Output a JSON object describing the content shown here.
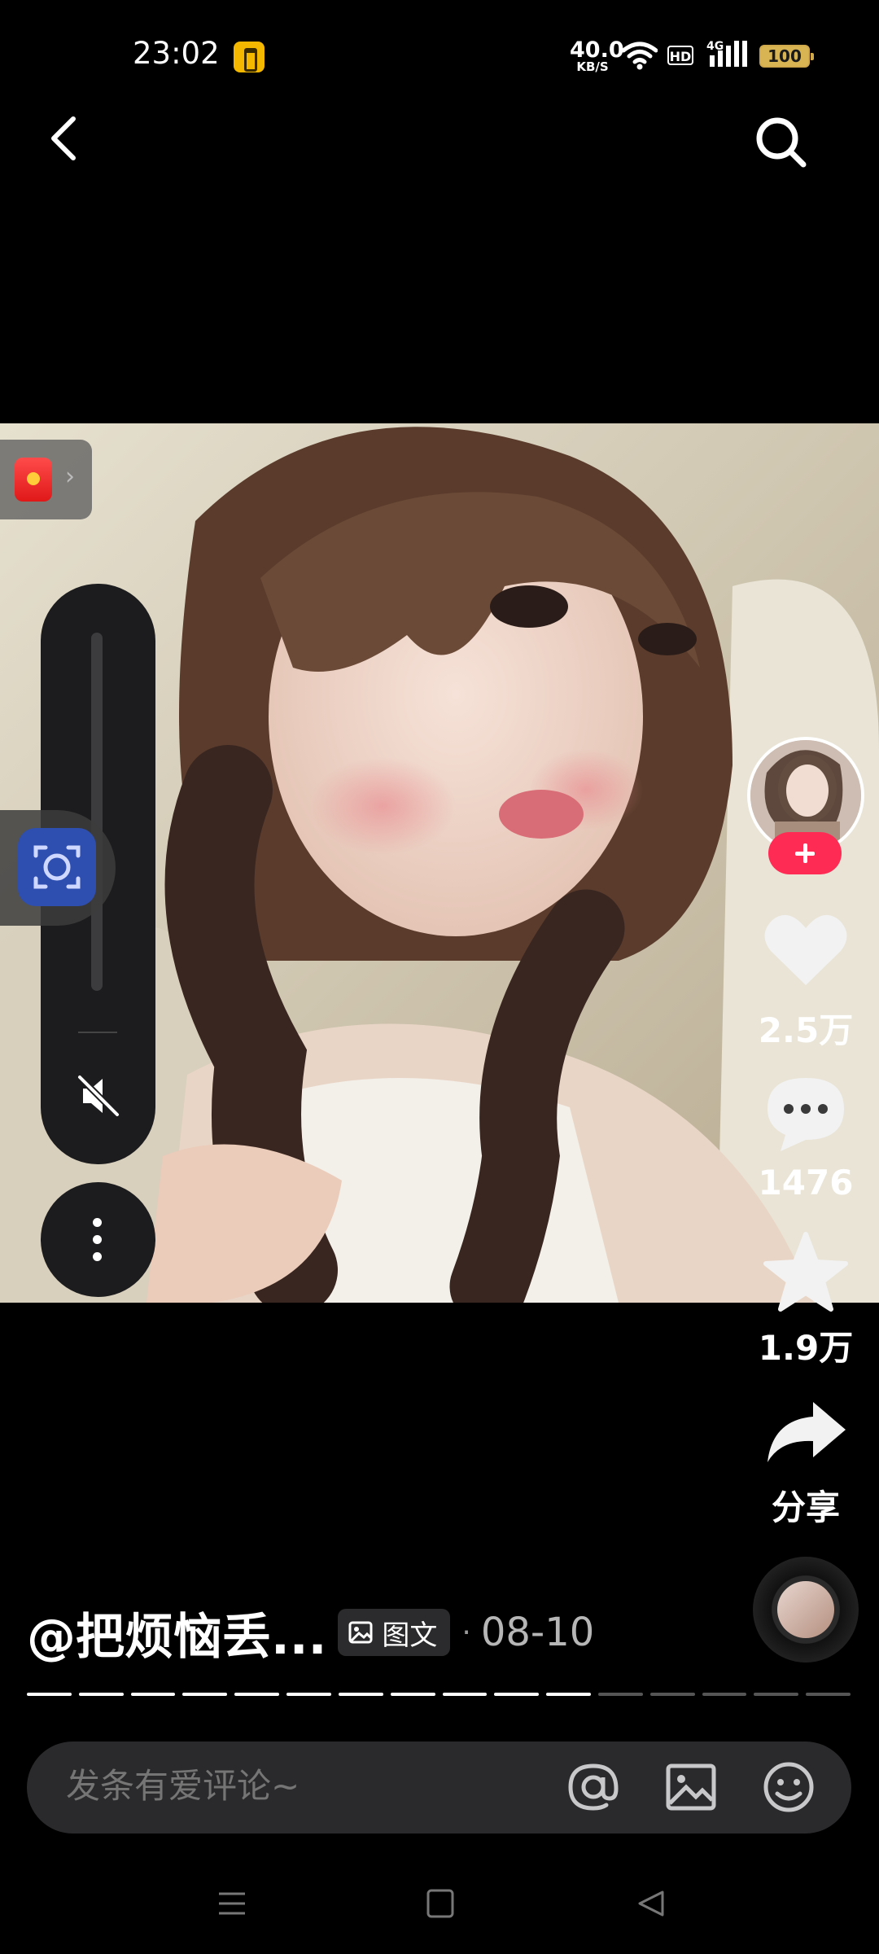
{
  "status_bar": {
    "time": "23:02",
    "net_speed_value": "40.0",
    "net_speed_unit": "KB/S",
    "hd_label": "HD",
    "network_label": "4G",
    "battery_level": "100"
  },
  "actions": {
    "like_count": "2.5万",
    "comment_count": "1476",
    "favorite_count": "1.9万",
    "share_label": "分享"
  },
  "caption": {
    "author": "@把烦恼丢...",
    "post_type": "图文",
    "separator": "·",
    "date": "08-10"
  },
  "image_progress": {
    "total": 16,
    "current": 11
  },
  "comment_bar": {
    "placeholder": "发条有爱评论~"
  },
  "colors": {
    "follow_accent": "#fe2c55",
    "background": "#000000"
  }
}
